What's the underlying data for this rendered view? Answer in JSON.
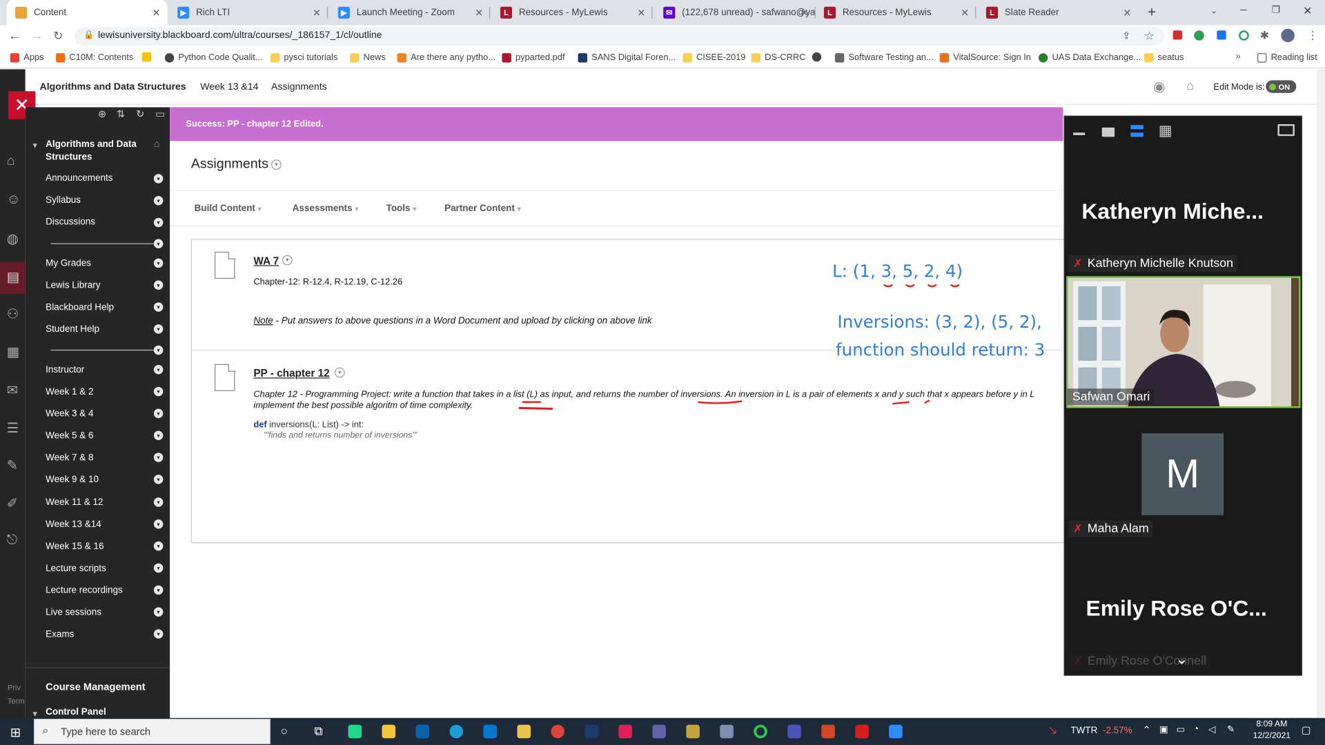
{
  "browser": {
    "tabs": [
      {
        "title": "Content"
      },
      {
        "title": "Rich LTI"
      },
      {
        "title": "Launch Meeting - Zoom"
      },
      {
        "title": "Resources - MyLewis"
      },
      {
        "title": "(122,678 unread) - safwano@ya"
      },
      {
        "title": "Resources - MyLewis"
      },
      {
        "title": "Slate Reader"
      }
    ],
    "url": "lewisuniversity.blackboard.com/ultra/courses/_186157_1/cl/outline",
    "bookmarks": [
      "Apps",
      "C10M: Contents",
      "Python Code Qualit...",
      "pysci tutorials",
      "News",
      "Are there any pytho...",
      "pyparted.pdf",
      "SANS Digital Foren...",
      "CISEE-2019",
      "DS-CRRC",
      "Software Testing an...",
      "VitalSource: Sign In",
      "UAS Data Exchange...",
      "seatus",
      "Reading list"
    ]
  },
  "header": {
    "course_title": "Algorithms and Data Structures",
    "crumb1": "Week 13 &14",
    "crumb2": "Assignments",
    "edit_mode_label": "Edit Mode is:",
    "edit_mode_value": "ON"
  },
  "sidebar": {
    "course_line1": "Algorithms and Data",
    "course_line2": "Structures",
    "group1": [
      "Announcements",
      "Syllabus",
      "Discussions"
    ],
    "group2": [
      "My Grades",
      "Lewis Library",
      "Blackboard Help",
      "Student Help"
    ],
    "group3": [
      "Instructor",
      "Week 1 & 2",
      "Week 3 & 4",
      "Week 5 & 6",
      "Week 7 & 8",
      "Week 9 & 10",
      "Week 11 & 12",
      "Week 13 &14",
      "Week 15 & 16",
      "Lecture scripts",
      "Lecture recordings",
      "Live sessions",
      "Exams"
    ],
    "course_management": "Course Management",
    "control_panel": "Control Panel",
    "footer1": "Priv",
    "footer2": "Term"
  },
  "banner": {
    "text": "Success: PP - chapter 12 Edited."
  },
  "main": {
    "title": "Assignments",
    "menu": [
      "Build Content",
      "Assessments",
      "Tools",
      "Partner Content"
    ],
    "items": [
      {
        "title": "WA 7",
        "line1": "Chapter-12: R-12.4, R-12.19, C-12.26",
        "note_label": "Note",
        "note_text": " - Put answers to above questions in a Word Document and upload by clicking on above link"
      },
      {
        "title": "PP - chapter 12",
        "desc1": "Chapter 12 - Programming Project: write a function that takes in a list (L) as input, and returns the number of inversions. An inversion in L is a pair of elements x and y such that x appears before y in L",
        "desc2": "implement the best possible algoritm of time complexity.",
        "code_kw": "def",
        "code_rest": " inversions(L: List) -> int:",
        "docstring": "'''finds and returns number of inversions'''"
      }
    ]
  },
  "annotations": {
    "list": "L: (1, 3, 5, 2, 4)",
    "inversions": "Inversions: (3, 2),  (5, 2),",
    "returns": "function should return: 3"
  },
  "zoom": {
    "p1_big": "Katheryn  Miche...",
    "p1_label": "Katheryn Michelle Knutson",
    "p2_label": "Safwan Omari",
    "p3_initial": "M",
    "p3_label": "Maha Alam",
    "p4_big": "Emily Rose  O'C...",
    "p4_label": "Emily Rose O'Connell"
  },
  "taskbar": {
    "search_placeholder": "Type here to search",
    "ticker": "TWTR",
    "ticker_change": "-2.57%",
    "time": "8:09 AM",
    "date": "12/2/2021"
  },
  "colors": {
    "banner": "#c66fd0",
    "accent_red": "#c8102e",
    "annotation_blue": "#2f7ed8",
    "speaker_border": "#7bc043"
  }
}
